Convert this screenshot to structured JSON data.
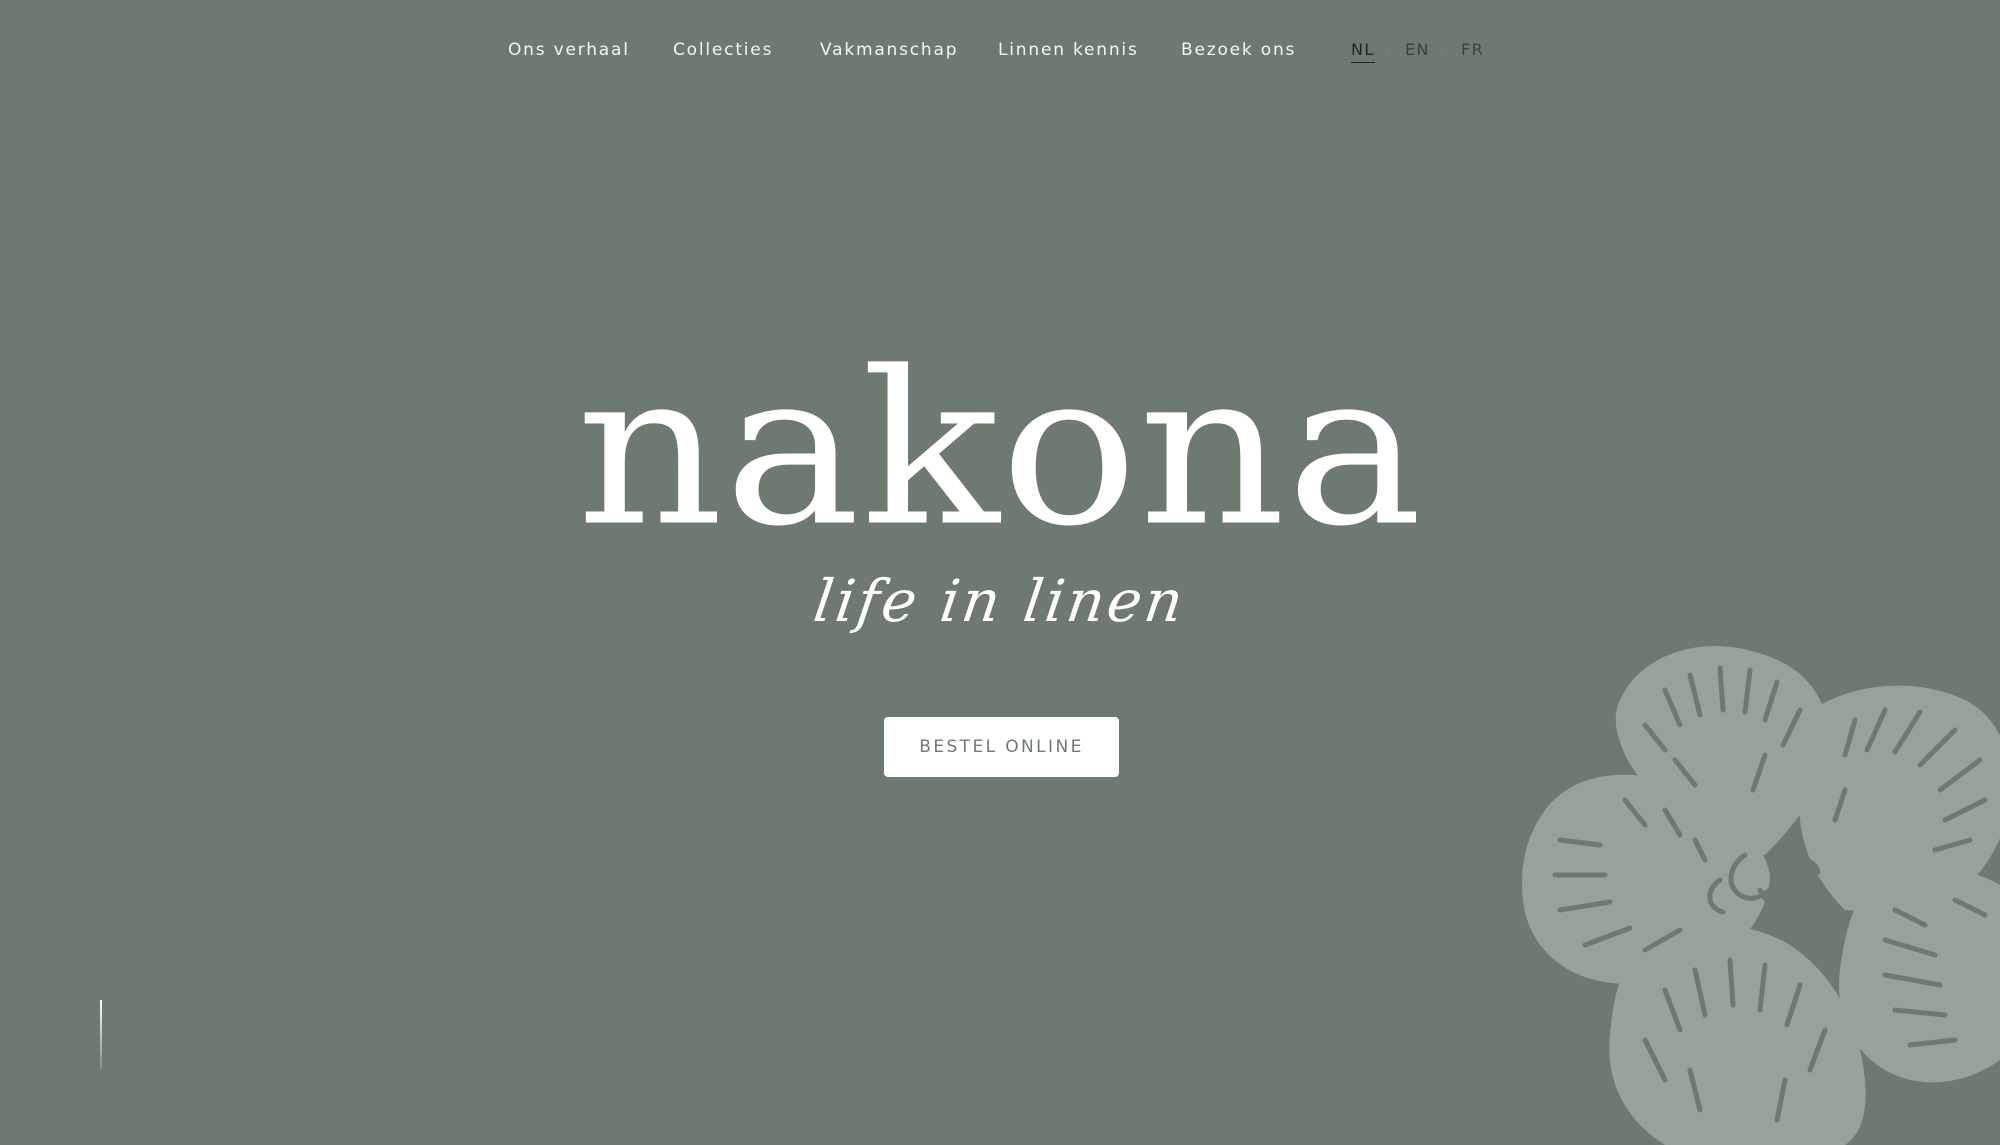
{
  "nav": {
    "items": [
      {
        "label": "Ons verhaal"
      },
      {
        "label": "Collecties"
      },
      {
        "label": "Vakmanschap"
      },
      {
        "label": "Linnen kennis"
      },
      {
        "label": "Bezoek ons"
      }
    ],
    "languages": [
      {
        "code": "NL",
        "active": true
      },
      {
        "code": "EN",
        "active": false
      },
      {
        "code": "FR",
        "active": false
      }
    ],
    "separator": "·"
  },
  "hero": {
    "brand": "nakona",
    "tagline": "life in linen",
    "cta_label": "BESTEL ONLINE"
  },
  "decor": {
    "flower_icon": "flower-illustration-icon",
    "scroll_icon": "scroll-indicator-icon"
  },
  "colors": {
    "background": "#6e7a70",
    "text": "#ffffff",
    "flower": "#97a299",
    "button_text": "#6f7a72"
  }
}
